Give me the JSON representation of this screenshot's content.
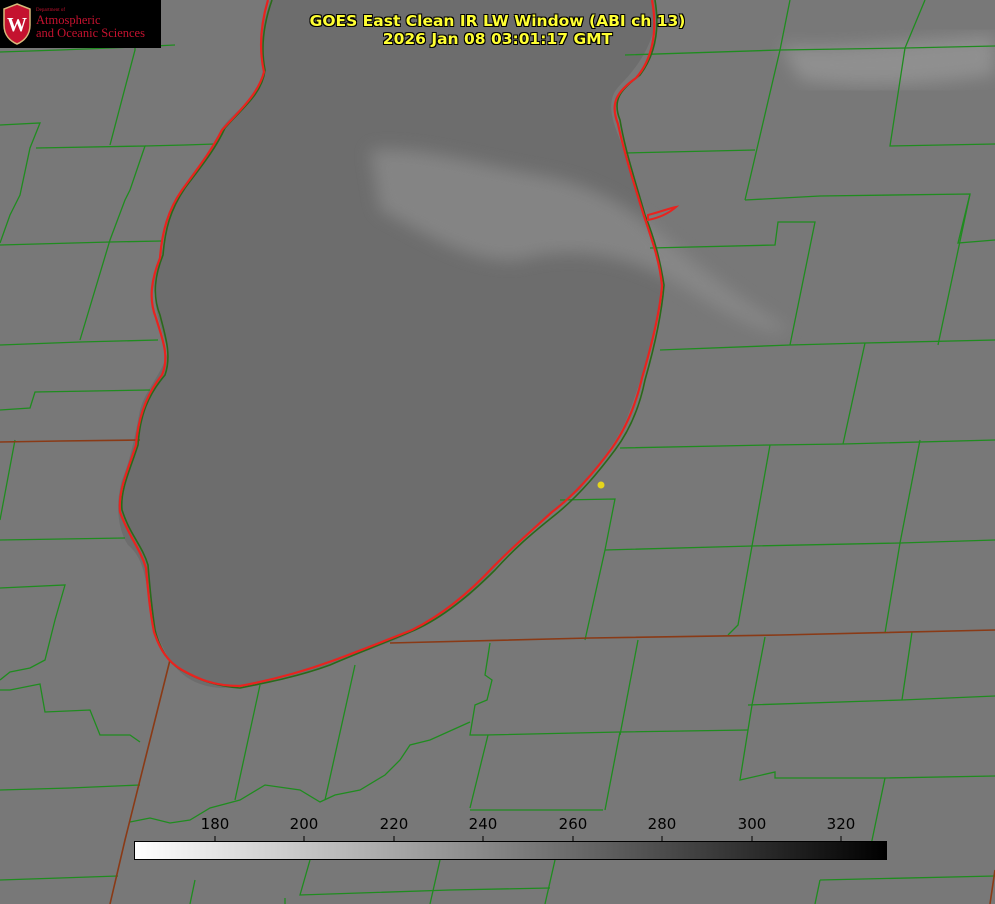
{
  "title": {
    "line1": "GOES East Clean IR LW Window (ABI ch 13)",
    "line2": "2026 Jan 08 03:01:17 GMT"
  },
  "logo": {
    "dept": "Department of",
    "line1": "Atmospheric",
    "line2": "and Oceanic Sciences",
    "seal_letter": "W"
  },
  "colorbar": {
    "ticks": [
      "180",
      "200",
      "220",
      "240",
      "260",
      "280",
      "300",
      "320"
    ],
    "min_value": 162,
    "max_value": 330,
    "colormap": "white-to-black grayscale"
  },
  "colors": {
    "background_gray": "#767676",
    "county_lines": "#1f8c1f",
    "state_lines": "#8a3a16",
    "lake_outline": "#e8231f",
    "title_text": "#ffff33",
    "marker": "#e5d51c",
    "logo_red": "#c4122f"
  }
}
